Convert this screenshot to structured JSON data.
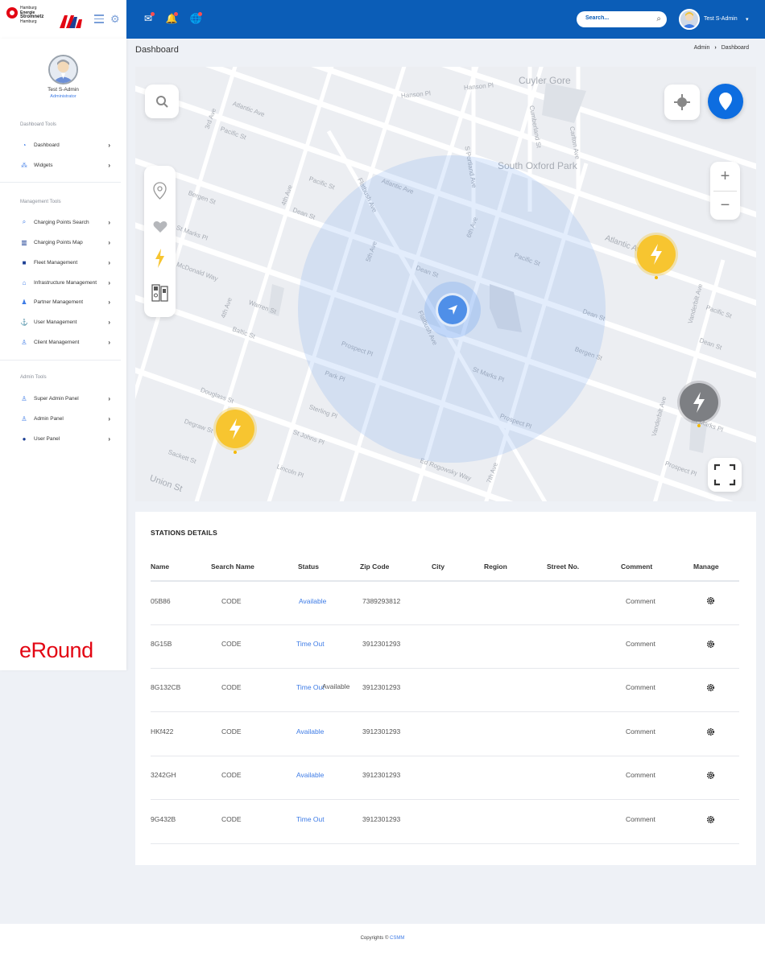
{
  "brand": {
    "logo_text_1": "Hamburg",
    "logo_text_2": "Energie",
    "logo_text_3": "Stromnetz",
    "logo_text_4": "Hamburg"
  },
  "header": {
    "search_placeholder": "Search...",
    "user_name": "Test S-Admin",
    "icons": [
      "mail-icon",
      "bell-icon",
      "globe-icon"
    ]
  },
  "sidebar": {
    "profile_name": "Test S-Admin",
    "profile_role": "Administrator",
    "sections": [
      {
        "title": "Dashboard Tools",
        "items": [
          {
            "label": "Dashboard",
            "icon": "dashboard-icon"
          },
          {
            "label": "Widgets",
            "icon": "widgets-icon"
          }
        ]
      },
      {
        "title": "Management Tools",
        "items": [
          {
            "label": "Charging Points Search",
            "icon": "search-icon"
          },
          {
            "label": "Charging Points Map",
            "icon": "map-icon"
          },
          {
            "label": "Fleet Management",
            "icon": "fleet-icon"
          },
          {
            "label": "Infrastructure Management",
            "icon": "infrastructure-icon"
          },
          {
            "label": "Partner Management",
            "icon": "partner-icon"
          },
          {
            "label": "User Management",
            "icon": "user-management-icon"
          },
          {
            "label": "Client Management",
            "icon": "client-icon"
          }
        ]
      },
      {
        "title": "Admin Tools",
        "items": [
          {
            "label": "Super Admin Panel",
            "icon": "super-admin-icon"
          },
          {
            "label": "Admin Panel",
            "icon": "admin-icon"
          },
          {
            "label": "User Panel",
            "icon": "user-icon"
          }
        ]
      }
    ],
    "footer_logo": "eRound"
  },
  "page": {
    "title": "Dashboard",
    "breadcrumb": [
      "Admin",
      "Dashboard"
    ]
  },
  "map": {
    "labels": [
      "Atlantic Ave",
      "Pacific St",
      "Dean St",
      "Bergen St",
      "St Marks Pl",
      "Flatbush Ave",
      "5th Ave",
      "4th Ave",
      "6th Ave",
      "3rd Ave",
      "Warren St",
      "Baltic St",
      "Prospect Pl",
      "Park Pl",
      "Sterling Pl",
      "St Johns Pl",
      "Lincoln Pl",
      "Douglass St",
      "Degraw St",
      "Sackett St",
      "Union St",
      "Ed Rogowsky Way",
      "Vanderbilt Ave",
      "Cumberland St",
      "Carlton Ave",
      "S Portland Ave",
      "South Oxford Park",
      "Cuyler Gore",
      "Hanson Pl",
      "McDonald Way",
      "7th Ave"
    ]
  },
  "table": {
    "title": "STATIONS  DETAILS",
    "columns": [
      "Name",
      "Search Name",
      "Status",
      "Zip Code",
      "City",
      "Region",
      "Street No.",
      "Comment",
      "Manage"
    ],
    "rows": [
      {
        "name": "05B86",
        "search_name": "CODE",
        "status": "Available",
        "zip": "7389293812",
        "city": "",
        "region": "",
        "street": "",
        "comment": "Comment"
      },
      {
        "name": "8G15B",
        "search_name": "CODE",
        "status": "Time Out",
        "zip": "3912301293",
        "city": "",
        "region": "",
        "street": "",
        "comment": "Comment"
      },
      {
        "name": "8G132CB",
        "search_name": "CODE",
        "status": "Time Out",
        "status_overlap": "Available",
        "zip": "3912301293",
        "city": "",
        "region": "",
        "street": "",
        "comment": "Comment"
      },
      {
        "name": "HKf422",
        "search_name": "CODE",
        "status": "Available",
        "zip": "3912301293",
        "city": "",
        "region": "",
        "street": "",
        "comment": "Comment"
      },
      {
        "name": "3242GH",
        "search_name": "CODE",
        "status": "Available",
        "zip": "3912301293",
        "city": "",
        "region": "",
        "street": "",
        "comment": "Comment"
      },
      {
        "name": "9G432B",
        "search_name": "CODE",
        "status": "Time Out",
        "zip": "3912301293",
        "city": "",
        "region": "",
        "street": "",
        "comment": "Comment"
      }
    ]
  },
  "footer": {
    "text": "Copyrights ©",
    "link": "CSMM"
  },
  "colors": {
    "topbar": "#0b5db7",
    "accent": "#3d7be6",
    "station_available": "#f7c530",
    "station_offline": "#7d7f83",
    "brand_red": "#e30613"
  }
}
